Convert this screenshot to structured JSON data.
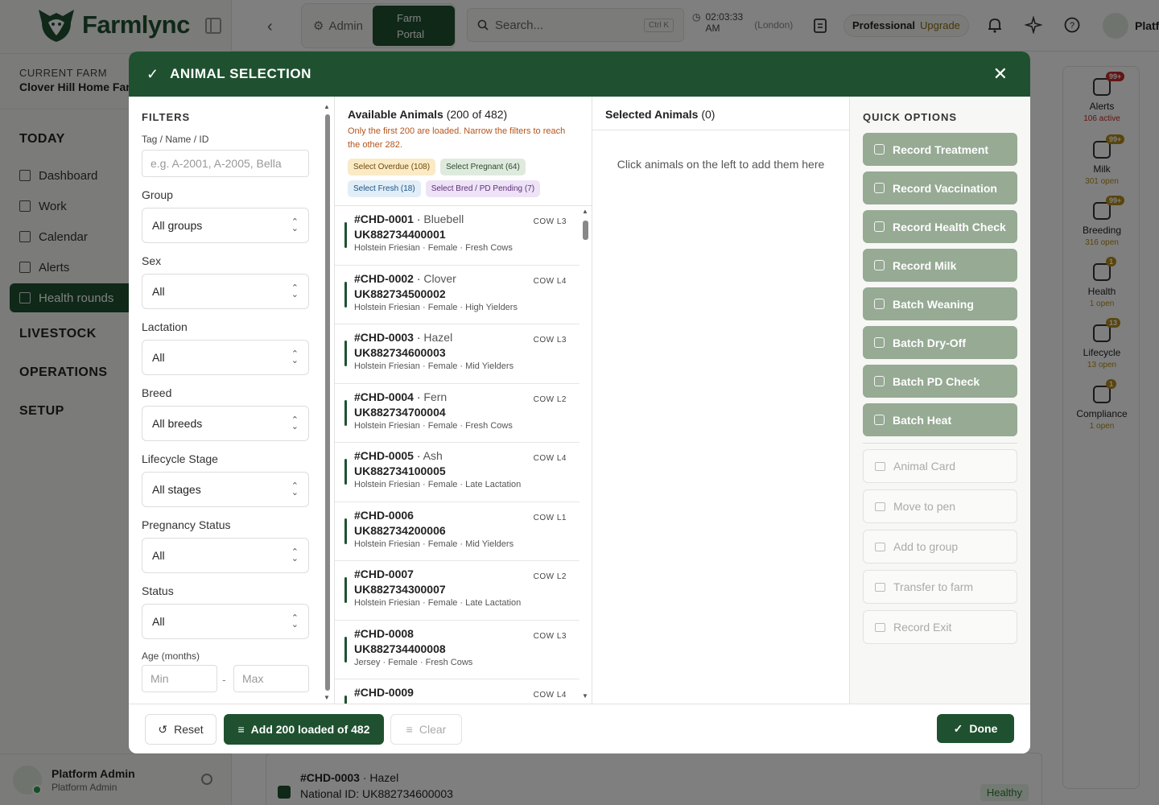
{
  "brand": {
    "name": "Farmlync",
    "color": "#1f5130"
  },
  "sidebar": {
    "farm_caption": "CURRENT FARM",
    "farm_name": "Clover Hill Home Farm",
    "sections": {
      "today": "TODAY",
      "livestock": "LIVESTOCK",
      "operations": "OPERATIONS",
      "setup": "SETUP"
    },
    "items": [
      {
        "label": "Dashboard",
        "icon": "grid-icon"
      },
      {
        "label": "Work",
        "icon": "clipboard-icon"
      },
      {
        "label": "Calendar",
        "icon": "calendar-icon"
      },
      {
        "label": "Alerts",
        "icon": "alert-icon"
      },
      {
        "label": "Health rounds",
        "icon": "stethoscope-icon",
        "active": true
      }
    ],
    "user": {
      "name": "Platform Admin",
      "role": "Platform Admin"
    }
  },
  "topbar": {
    "tab_admin": "Admin",
    "tab_farm_line1": "Farm",
    "tab_farm_line2": "Portal",
    "search_placeholder": "Search...",
    "search_shortcut": "Ctrl K",
    "clock_time": "02:03:33",
    "clock_ampm": "AM",
    "clock_tz": "(London)",
    "plan": "Professional",
    "upgrade": "Upgrade",
    "user_short": "Platf"
  },
  "rail": [
    {
      "label": "Alerts",
      "badge": "99+",
      "sub": "106 active",
      "urgent": true
    },
    {
      "label": "Milk",
      "badge": "99+",
      "sub": "301 open"
    },
    {
      "label": "Breeding",
      "badge": "99+",
      "sub": "316 open"
    },
    {
      "label": "Health",
      "badge": "1",
      "sub": "1 open"
    },
    {
      "label": "Lifecycle",
      "badge": "13",
      "sub": "13 open"
    },
    {
      "label": "Compliance",
      "badge": "1",
      "sub": "1 open"
    }
  ],
  "background_row": {
    "tag": "#CHD-0003",
    "name": "Hazel",
    "national_label": "National ID: UK882734600003",
    "status": "Healthy"
  },
  "modal": {
    "title": "ANIMAL SELECTION",
    "filters": {
      "title": "FILTERS",
      "tag_label": "Tag / Name / ID",
      "tag_placeholder": "e.g. A-2001, A-2005, Bella",
      "group_label": "Group",
      "group_value": "All groups",
      "sex_label": "Sex",
      "sex_value": "All",
      "lactation_label": "Lactation",
      "lactation_value": "All",
      "breed_label": "Breed",
      "breed_value": "All breeds",
      "lifecycle_label": "Lifecycle Stage",
      "lifecycle_value": "All stages",
      "pregnancy_label": "Pregnancy Status",
      "pregnancy_value": "All",
      "status_label": "Status",
      "status_value": "All",
      "age_label": "Age (months)",
      "age_min": "Min",
      "age_max": "Max",
      "age_sep": "-"
    },
    "available": {
      "title": "Available Animals",
      "count": "(200 of 482)",
      "warning": "Only the first 200 are loaded. Narrow the filters to reach the other 282.",
      "chips": {
        "overdue": "Select Overdue (108)",
        "pregnant": "Select Pregnant (64)",
        "fresh": "Select Fresh (18)",
        "bred": "Select Bred / PD Pending (7)"
      },
      "animals": [
        {
          "tag": "#CHD-0001",
          "name": "Bluebell",
          "uk": "UK882734400001",
          "meta": "Holstein Friesian · Female · Fresh Cows",
          "badge": "COW L3"
        },
        {
          "tag": "#CHD-0002",
          "name": "Clover",
          "uk": "UK882734500002",
          "meta": "Holstein Friesian · Female · High Yielders",
          "badge": "COW L4"
        },
        {
          "tag": "#CHD-0003",
          "name": "Hazel",
          "uk": "UK882734600003",
          "meta": "Holstein Friesian · Female · Mid Yielders",
          "badge": "COW L3"
        },
        {
          "tag": "#CHD-0004",
          "name": "Fern",
          "uk": "UK882734700004",
          "meta": "Holstein Friesian · Female · Fresh Cows",
          "badge": "COW L2"
        },
        {
          "tag": "#CHD-0005",
          "name": "Ash",
          "uk": "UK882734100005",
          "meta": "Holstein Friesian · Female · Late Lactation",
          "badge": "COW L4"
        },
        {
          "tag": "#CHD-0006",
          "name": "",
          "uk": "UK882734200006",
          "meta": "Holstein Friesian · Female · Mid Yielders",
          "badge": "COW L1"
        },
        {
          "tag": "#CHD-0007",
          "name": "",
          "uk": "UK882734300007",
          "meta": "Holstein Friesian · Female · Late Lactation",
          "badge": "COW L2"
        },
        {
          "tag": "#CHD-0008",
          "name": "",
          "uk": "UK882734400008",
          "meta": "Jersey · Female · Fresh Cows",
          "badge": "COW L3"
        },
        {
          "tag": "#CHD-0009",
          "name": "",
          "uk": "",
          "meta": "",
          "badge": "COW L4"
        }
      ]
    },
    "selected": {
      "title": "Selected Animals",
      "count": "(0)",
      "empty": "Click animals on the left to add them here"
    },
    "quick": {
      "title": "QUICK OPTIONS",
      "primary": [
        "Record Treatment",
        "Record Vaccination",
        "Record Health Check",
        "Record Milk",
        "Batch Weaning",
        "Batch Dry-Off",
        "Batch PD Check",
        "Batch Heat"
      ],
      "secondary": [
        "Animal Card",
        "Move to pen",
        "Add to group",
        "Transfer to farm",
        "Record Exit"
      ]
    },
    "footer": {
      "reset": "Reset",
      "add": "Add 200 loaded of 482",
      "clear": "Clear",
      "done": "Done"
    }
  }
}
